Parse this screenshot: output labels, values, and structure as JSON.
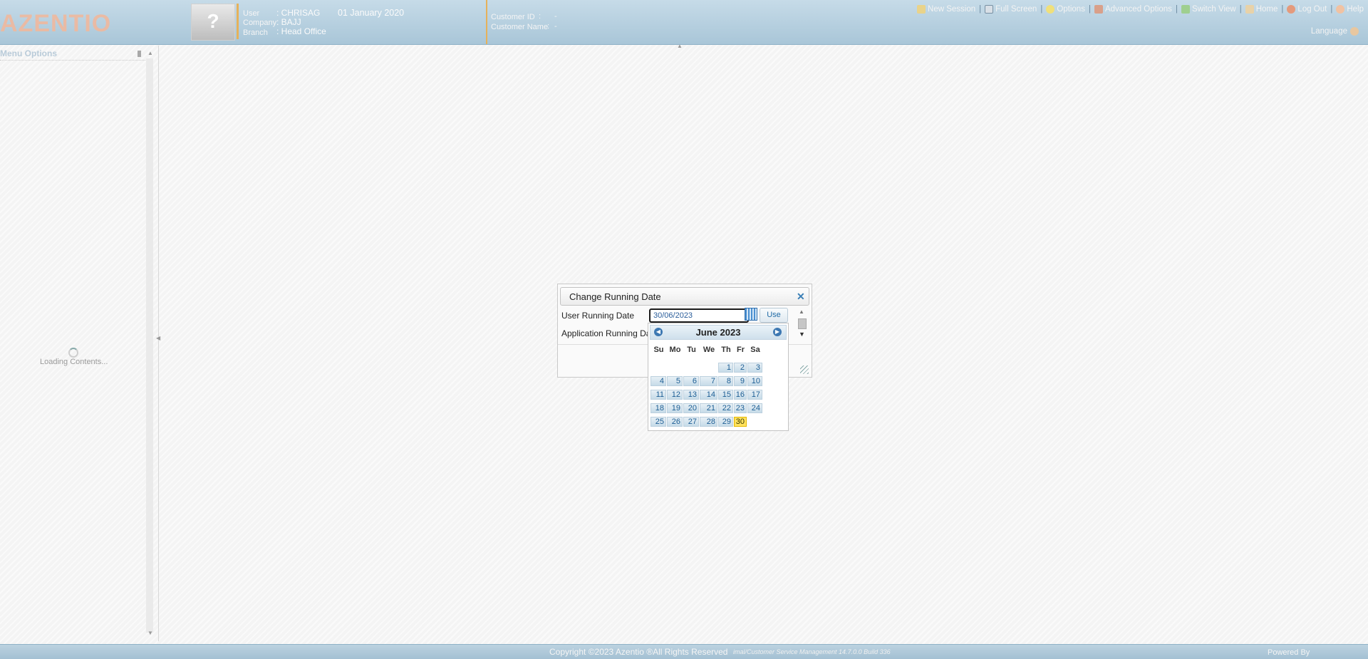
{
  "header": {
    "logo_text": "AZENTIO",
    "avatar_glyph": "?",
    "user_label": "User",
    "user_value": ": CHRISAG",
    "date": "01 January 2020",
    "company_label": "Company",
    "company_value": ": BAJJ",
    "branch_label": "Branch",
    "branch_value": ": Head Office",
    "customer_id_label": "Customer ID",
    "customer_id_value": ":",
    "customer_id_dash": "-",
    "customer_name_label": "Customer Name",
    "customer_name_value": ":",
    "customer_name_dash": "-",
    "toolbar": {
      "new_session": "New Session",
      "full_screen": "Full Screen",
      "options": "Options",
      "advanced_options": "Advanced Options",
      "switch_view": "Switch View",
      "home": "Home",
      "log_out": "Log Out",
      "help": "Help"
    },
    "language_label": "Language"
  },
  "menu": {
    "title": "Menu Options",
    "loading_text": "Loading Contents..."
  },
  "dialog": {
    "title": "Change Running Date",
    "user_running_date_label": "User Running Date",
    "user_running_date_value": "30/06/2023",
    "application_running_date_label": "Application Running Date",
    "use_button": "Use"
  },
  "calendar": {
    "month_title": "June 2023",
    "weekdays": [
      "Su",
      "Mo",
      "Tu",
      "We",
      "Th",
      "Fr",
      "Sa"
    ],
    "first_weekday_index": 4,
    "days_in_month": 30,
    "selected_day": 30
  },
  "footer": {
    "copyright": "Copyright ©2023 Azentio ®All Rights Reserved",
    "version": "imal/Customer Service Management 14.7.0.0 Build 336",
    "powered_by": "Powered By"
  },
  "colors": {
    "header_bg": "#b7d0e0",
    "accent_orange": "#e6b15a",
    "calendar_selected": "#ffe25e",
    "link_blue": "#1f6aa5"
  },
  "icons": {
    "new_session": "pencil-icon",
    "full_screen": "fullscreen-icon",
    "options": "lightbulb-icon",
    "advanced_options": "tools-icon",
    "switch_view": "switch-view-icon",
    "home": "home-icon",
    "log_out": "logout-icon",
    "help": "help-icon",
    "language": "person-icon",
    "calendar": "calendar-icon",
    "close": "close-icon"
  }
}
